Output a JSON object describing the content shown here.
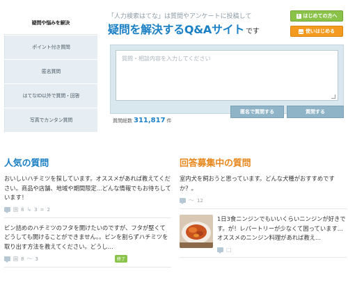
{
  "sidebar": {
    "items": [
      {
        "label": "疑問や悩みを解決"
      },
      {
        "label": "ポイント付き質問"
      },
      {
        "label": "匿名質問"
      },
      {
        "label": "はてなID以外で質問・回答"
      },
      {
        "label": "写真でカンタン質問"
      }
    ]
  },
  "header": {
    "tagline": "「人力検索はてな」は質問やアンケートに投稿して",
    "headline": "疑問を解決するQ&Aサイト",
    "headline_suffix": "です",
    "start_label": "はじめての方へ",
    "howto_label": "使いはじめる"
  },
  "question_form": {
    "placeholder": "質問・相談内容を入力してください",
    "count_prefix": "質問総数",
    "count_value": "311,817",
    "count_suffix": "件",
    "anon_button": "匿名で質問する",
    "ask_button": "質問する"
  },
  "popular": {
    "title": "人気の質問",
    "items": [
      {
        "text": "おいしいハチミツを探しています。オススメがあれば教えてください。商品や店舗、地域や期間限定...どんな情報でもお待ちしています！",
        "meta_a": "8",
        "meta_b": "3",
        "meta_c": "2"
      },
      {
        "text": "ビン詰めのハチミツのフタを開けたいのですが、フタが堅くてどうしても開けることができません。。ビンを割らずハチミツを取り出す方法を教えてください。どうし...",
        "meta_a": "8",
        "meta_b": "3",
        "badge": "終了"
      }
    ]
  },
  "recruiting": {
    "title": "回答募集中の質問",
    "items": [
      {
        "text": "室内犬を飼おうと思っています。どんな犬種がおすすめですか？。",
        "meta_b": "12"
      },
      {
        "text": "1日3食ニンジンでもいいくらいニンジンが好きです。が！レパートリーが少なくて困っています...オススメのニンジン料理があれば教え...",
        "thumb": "carrot-dish-photo"
      }
    ]
  },
  "colors": {
    "accent_blue": "#1a7fc4",
    "accent_orange": "#e8861b",
    "green": "#8bc34a"
  }
}
